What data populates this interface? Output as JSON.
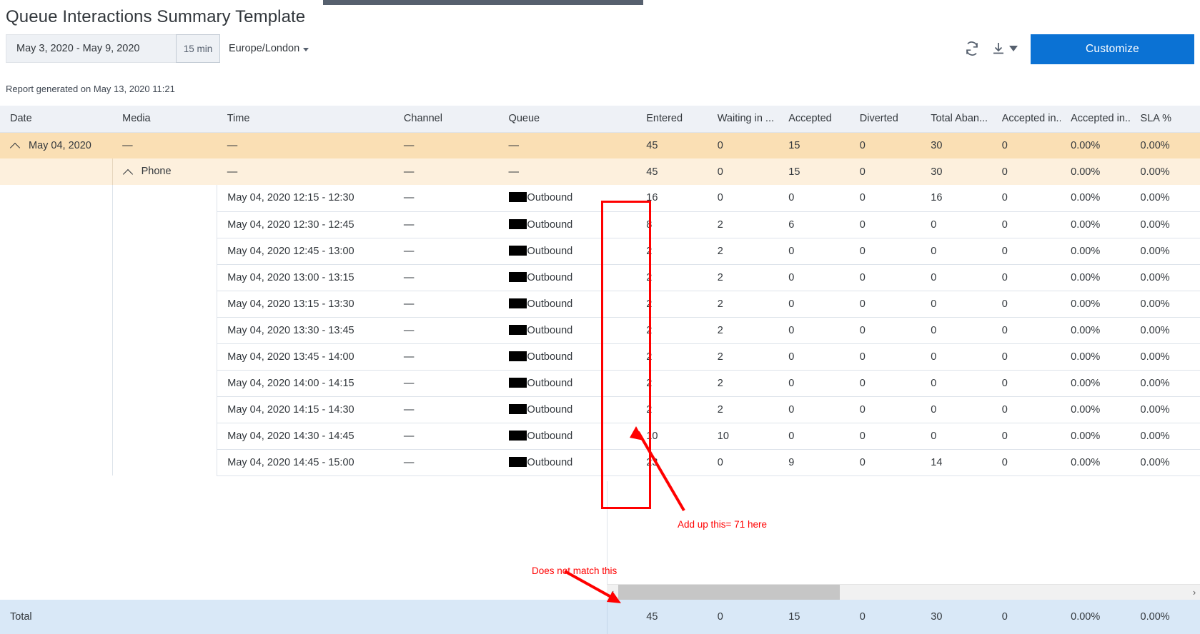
{
  "page": {
    "title": "Queue Interactions Summary Template",
    "generated": "Report generated on May 13, 2020 11:21"
  },
  "controls": {
    "date_range": "May 3, 2020 - May 9, 2020",
    "interval": "15 min",
    "timezone": "Europe/London",
    "refresh_icon": "refresh-icon",
    "export_icon": "download-icon",
    "export_caret_icon": "caret-down-icon",
    "customize_label": "Customize"
  },
  "table": {
    "columns": [
      "Date",
      "Media",
      "Time",
      "Channel",
      "Queue",
      "Entered",
      "Waiting in ...",
      "Accepted",
      "Diverted",
      "Total Aban...",
      "Accepted in...",
      "Accepted in...",
      "SLA %"
    ],
    "group_row": {
      "date": "May 04, 2020",
      "media": "—",
      "time": "—",
      "channel": "—",
      "queue": "—",
      "entered": "45",
      "waiting": "0",
      "accepted": "15",
      "diverted": "0",
      "total_abandoned": "30",
      "accepted_in_a": "0",
      "accepted_in_b": "0.00%",
      "sla": "0.00%"
    },
    "media_row": {
      "media": "Phone",
      "time": "—",
      "channel": "—",
      "queue": "—",
      "entered": "45",
      "waiting": "0",
      "accepted": "15",
      "diverted": "0",
      "total_abandoned": "30",
      "accepted_in_a": "0",
      "accepted_in_b": "0.00%",
      "sla": "0.00%"
    },
    "queue_label": "Outbound",
    "rows": [
      {
        "time": "May 04, 2020 12:15 - 12:30",
        "channel": "—",
        "queue": "Outbound",
        "entered": "16",
        "waiting": "0",
        "accepted": "0",
        "diverted": "0",
        "total_abandoned": "16",
        "accepted_in_a": "0",
        "accepted_in_b": "0.00%",
        "sla": "0.00%"
      },
      {
        "time": "May 04, 2020 12:30 - 12:45",
        "channel": "—",
        "queue": "Outbound",
        "entered": "8",
        "waiting": "2",
        "accepted": "6",
        "diverted": "0",
        "total_abandoned": "0",
        "accepted_in_a": "0",
        "accepted_in_b": "0.00%",
        "sla": "0.00%"
      },
      {
        "time": "May 04, 2020 12:45 - 13:00",
        "channel": "—",
        "queue": "Outbound",
        "entered": "2",
        "waiting": "2",
        "accepted": "0",
        "diverted": "0",
        "total_abandoned": "0",
        "accepted_in_a": "0",
        "accepted_in_b": "0.00%",
        "sla": "0.00%"
      },
      {
        "time": "May 04, 2020 13:00 - 13:15",
        "channel": "—",
        "queue": "Outbound",
        "entered": "2",
        "waiting": "2",
        "accepted": "0",
        "diverted": "0",
        "total_abandoned": "0",
        "accepted_in_a": "0",
        "accepted_in_b": "0.00%",
        "sla": "0.00%"
      },
      {
        "time": "May 04, 2020 13:15 - 13:30",
        "channel": "—",
        "queue": "Outbound",
        "entered": "2",
        "waiting": "2",
        "accepted": "0",
        "diverted": "0",
        "total_abandoned": "0",
        "accepted_in_a": "0",
        "accepted_in_b": "0.00%",
        "sla": "0.00%"
      },
      {
        "time": "May 04, 2020 13:30 - 13:45",
        "channel": "—",
        "queue": "Outbound",
        "entered": "2",
        "waiting": "2",
        "accepted": "0",
        "diverted": "0",
        "total_abandoned": "0",
        "accepted_in_a": "0",
        "accepted_in_b": "0.00%",
        "sla": "0.00%"
      },
      {
        "time": "May 04, 2020 13:45 - 14:00",
        "channel": "—",
        "queue": "Outbound",
        "entered": "2",
        "waiting": "2",
        "accepted": "0",
        "diverted": "0",
        "total_abandoned": "0",
        "accepted_in_a": "0",
        "accepted_in_b": "0.00%",
        "sla": "0.00%"
      },
      {
        "time": "May 04, 2020 14:00 - 14:15",
        "channel": "—",
        "queue": "Outbound",
        "entered": "2",
        "waiting": "2",
        "accepted": "0",
        "diverted": "0",
        "total_abandoned": "0",
        "accepted_in_a": "0",
        "accepted_in_b": "0.00%",
        "sla": "0.00%"
      },
      {
        "time": "May 04, 2020 14:15 - 14:30",
        "channel": "—",
        "queue": "Outbound",
        "entered": "2",
        "waiting": "2",
        "accepted": "0",
        "diverted": "0",
        "total_abandoned": "0",
        "accepted_in_a": "0",
        "accepted_in_b": "0.00%",
        "sla": "0.00%"
      },
      {
        "time": "May 04, 2020 14:30 - 14:45",
        "channel": "—",
        "queue": "Outbound",
        "entered": "10",
        "waiting": "10",
        "accepted": "0",
        "diverted": "0",
        "total_abandoned": "0",
        "accepted_in_a": "0",
        "accepted_in_b": "0.00%",
        "sla": "0.00%"
      },
      {
        "time": "May 04, 2020 14:45 - 15:00",
        "channel": "—",
        "queue": "Outbound",
        "entered": "23",
        "waiting": "0",
        "accepted": "9",
        "diverted": "0",
        "total_abandoned": "14",
        "accepted_in_a": "0",
        "accepted_in_b": "0.00%",
        "sla": "0.00%"
      }
    ],
    "total": {
      "label": "Total",
      "entered": "45",
      "waiting": "0",
      "accepted": "15",
      "diverted": "0",
      "total_abandoned": "30",
      "accepted_in_a": "0",
      "accepted_in_b": "0.00%",
      "sla": "0.00%"
    }
  },
  "scrollbar": {
    "left_arrow": "‹",
    "right_arrow": "›"
  },
  "annotations": {
    "sum_note": "Add up this= 71 here",
    "mismatch_note": "Does not match this",
    "color": "#ff0000"
  }
}
